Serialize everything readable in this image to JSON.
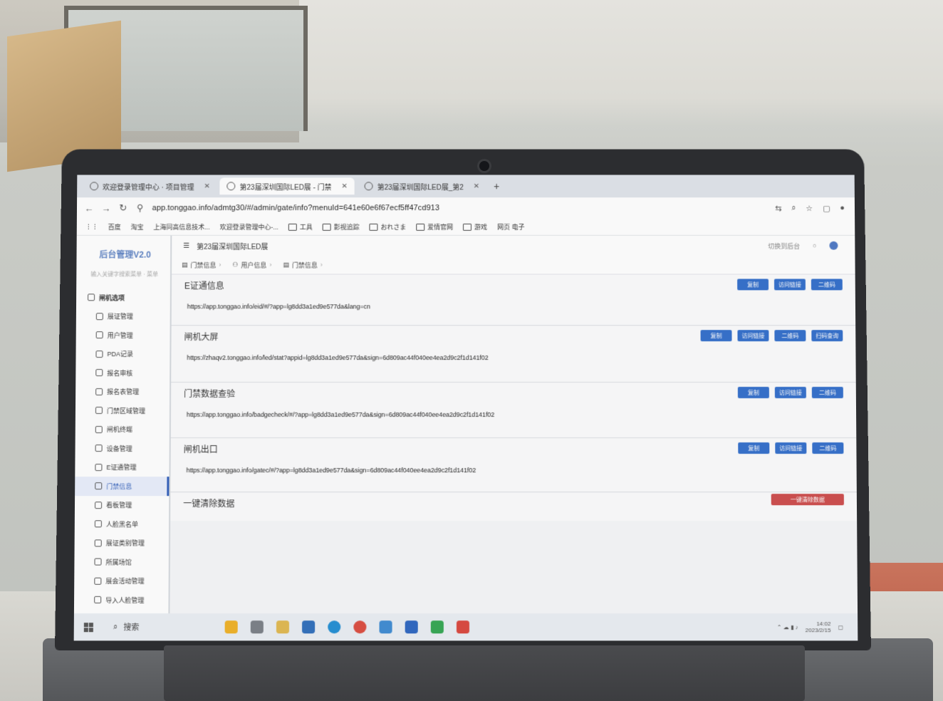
{
  "browser": {
    "tabs": [
      {
        "label": "欢迎登录管理中心 · 项目管理",
        "active": false
      },
      {
        "label": "第23届深圳国际LED展 - 门禁",
        "active": true
      },
      {
        "label": "第23届深圳国际LED展_第2",
        "active": false
      }
    ],
    "new_tab": "+",
    "url": "app.tonggao.info/admtg30/#/admin/gate/info?menuId=641e60e6f67ecf5ff47cd913",
    "bookmarks": [
      "百度",
      "淘宝",
      "上海同高信息技术...",
      "欢迎登录管理中心-...",
      "工具",
      "影视追踪",
      "おれさま",
      "爱情官网",
      "游戏",
      "网页 电子"
    ]
  },
  "sidebar": {
    "brand": "后台管理V2.0",
    "search_placeholder": "输入关键字搜索菜单 · 菜单",
    "menu": [
      {
        "label": "闸机选项",
        "group": true
      },
      {
        "label": "展证管理"
      },
      {
        "label": "用户管理"
      },
      {
        "label": "PDA记录"
      },
      {
        "label": "报名审核"
      },
      {
        "label": "报名表管理"
      },
      {
        "label": "门禁区域管理"
      },
      {
        "label": "闸机终端"
      },
      {
        "label": "设备管理"
      },
      {
        "label": "E证通管理"
      },
      {
        "label": "门禁信息",
        "active": true
      },
      {
        "label": "看板管理"
      },
      {
        "label": "人脸黑名单"
      },
      {
        "label": "展证类别管理"
      },
      {
        "label": "所属场馆"
      },
      {
        "label": "展会活动管理"
      },
      {
        "label": "导入人脸管理"
      }
    ]
  },
  "header": {
    "page_title": "第23届深圳国际LED展",
    "right_link": "切换到后台",
    "breadcrumbs": [
      "门禁信息",
      "用户信息",
      "门禁信息"
    ]
  },
  "sections": [
    {
      "title": "E证通信息",
      "url": "https://app.tonggao.info/eid/#/?app=lg8dd3a1ed9e577da&lang=cn",
      "buttons": [
        "复制",
        "访问链接",
        "二维码"
      ]
    },
    {
      "title": "闸机大屏",
      "url": "https://zhaqv2.tonggao.info/led/stat?appid=lg8dd3a1ed9e577da&sign=6d809ac44f040ee4ea2d9c2f1d141f02",
      "buttons": [
        "复制",
        "访问链接",
        "二维码",
        "扫码查询"
      ]
    },
    {
      "title": "门禁数据查验",
      "url": "https://app.tonggao.info/badgecheck/#/?app=lg8dd3a1ed9e577da&sign=6d809ac44f040ee4ea2d9c2f1d141f02",
      "buttons": [
        "复制",
        "访问链接",
        "二维码"
      ]
    },
    {
      "title": "闸机出口",
      "url": "https://app.tonggao.info/gatec/#/?app=lg8dd3a1ed9e577da&sign=6d809ac44f040ee4ea2d9c2f1d141f02",
      "buttons": [
        "复制",
        "访问链接",
        "二维码"
      ]
    },
    {
      "title": "一键清除数据",
      "url": "",
      "buttons": [
        "一键清除数据"
      ],
      "danger": true
    }
  ],
  "taskbar": {
    "search_label": "搜索",
    "clock": "14:02",
    "date": "2023/2/15"
  },
  "colors": {
    "primary_button": "#2f6ed0",
    "danger_button": "#d24a4a",
    "brand_text": "#5b82c7"
  }
}
